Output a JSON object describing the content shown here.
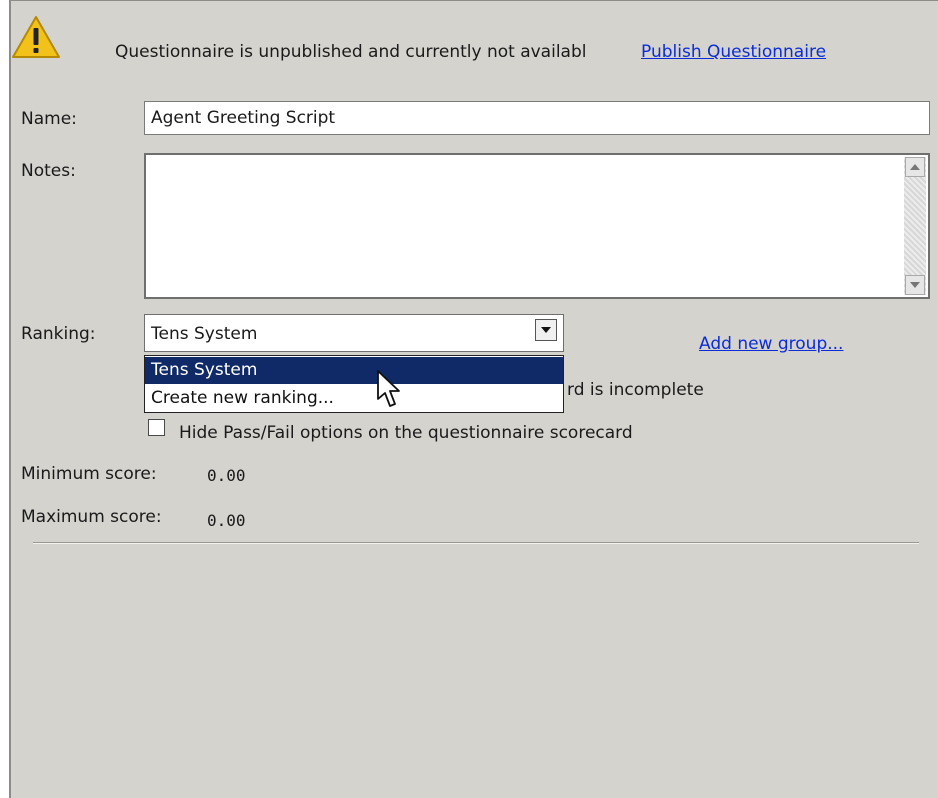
{
  "banner": {
    "message": "Questionnaire is unpublished and currently not availabl",
    "publish_link": "Publish Questionnaire",
    "icon": "warning-icon"
  },
  "form": {
    "name_label": "Name:",
    "name_value": "Agent Greeting Script",
    "notes_label": "Notes:",
    "notes_value": "",
    "ranking_label": "Ranking:",
    "ranking_selected": "Tens System",
    "ranking_options": [
      "Tens System",
      "Create new ranking..."
    ],
    "add_group_link": "Add new group...",
    "partial_checkbox_text_visible": "rd is incomplete",
    "hide_passfail_label": "Hide Pass/Fail options on the questionnaire scorecard",
    "hide_passfail_checked": false,
    "min_score_label": "Minimum score:",
    "min_score_value": "0.00",
    "max_score_label": "Maximum score:",
    "max_score_value": "0.00"
  },
  "colors": {
    "panel_bg": "#d5d3ce",
    "link": "#0b2cd8",
    "selection": "#102a68",
    "warning": "#f2c21b"
  }
}
